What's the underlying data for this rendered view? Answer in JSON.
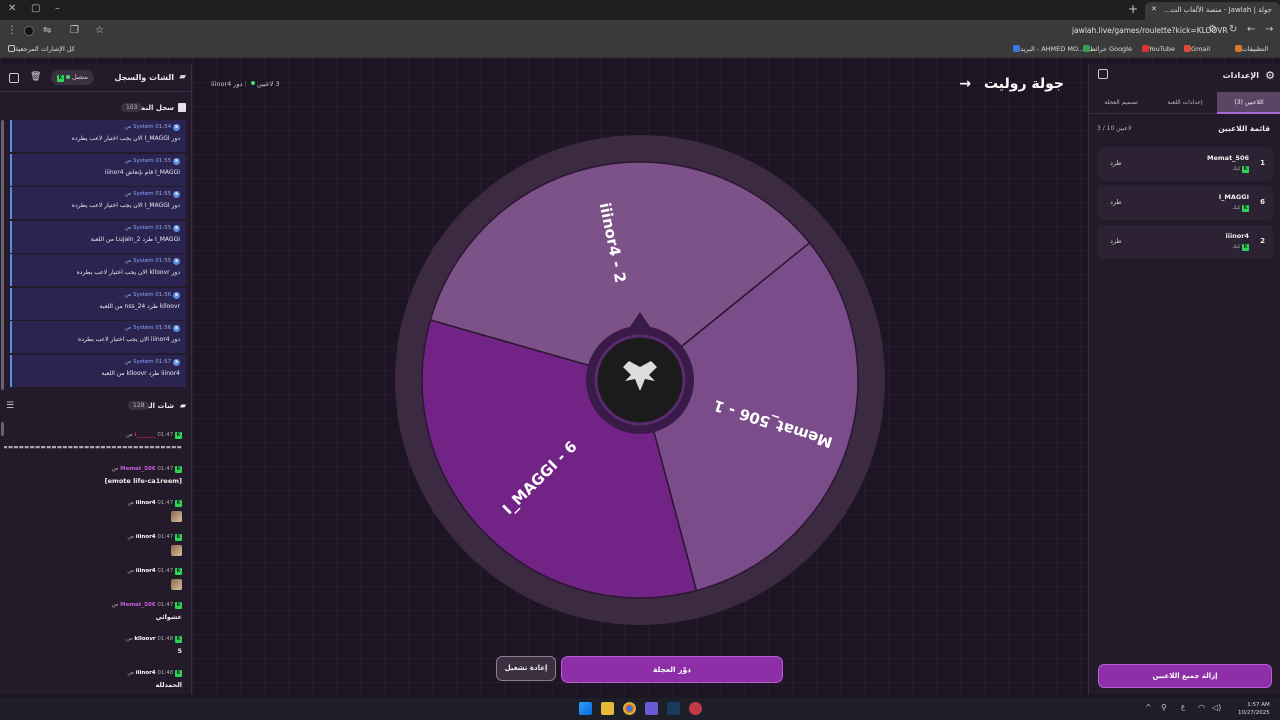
{
  "browser": {
    "tab_title": "جولة | Jawlah - منصة الألعاب الت...",
    "url": "jawlah.live/games/roulette?kick=KLOOVR",
    "bookmarks": [
      "التطبيقات",
      "Gmail",
      "YouTube",
      "خرائط Google",
      "البريد - AHMED MO...",
      "كل الإشارات المرجعية"
    ]
  },
  "left_panel": {
    "title": "الشات والسجل",
    "online_label": "متصل",
    "system_log": {
      "title": "سجل النظام",
      "count": "103",
      "messages": [
        {
          "sender": "System",
          "time": "01:54 ص",
          "text": "دور I_MAGGI الان يجب اختيار لاعب يطرده"
        },
        {
          "sender": "System",
          "time": "01:55 ص",
          "text": "I_MAGGI قام بإنعاش iiinor4"
        },
        {
          "sender": "System",
          "time": "01:55 ص",
          "text": "دور I_MAGGI الان يجب اختيار لاعب يطرده"
        },
        {
          "sender": "System",
          "time": "01:55 ص",
          "text": "I_MAGGI طرد Lujain_2 من اللعبة"
        },
        {
          "sender": "System",
          "time": "01:55 ص",
          "text": "دور klloovr الان يجب اختيار لاعب يطرده"
        },
        {
          "sender": "System",
          "time": "01:56 ص",
          "text": "klloovr طرد nss_24 من اللعبة"
        },
        {
          "sender": "System",
          "time": "01:56 ص",
          "text": "دور iiinor4 الان يجب اختيار لاعب يطرده"
        },
        {
          "sender": "System",
          "time": "01:57 ص",
          "text": "iiinor4 طرد klloovr من اللعبة"
        }
      ]
    },
    "live_chat": {
      "title": "شات البث",
      "count": "128",
      "messages": [
        {
          "name": "i_______",
          "name_color": "#e0245e",
          "time": "01:47 ص",
          "body": "==================================",
          "image": false
        },
        {
          "name": "Memat_506",
          "name_color": "#c060e0",
          "time": "01:47 ص",
          "body": "[emote life-ca1reem]",
          "image": false
        },
        {
          "name": "iiinor4",
          "name_color": "#ffffff",
          "time": "01:47 ص",
          "body": "",
          "image": true
        },
        {
          "name": "iiinor4",
          "name_color": "#ffffff",
          "time": "01:47 ص",
          "body": "",
          "image": true
        },
        {
          "name": "iiinor4",
          "name_color": "#ffffff",
          "time": "01:47 ص",
          "body": "",
          "image": true
        },
        {
          "name": "Memat_506",
          "name_color": "#c060e0",
          "time": "01:47 ص",
          "body": "عشوائي",
          "image": false
        },
        {
          "name": "klloovr",
          "name_color": "#ffffff",
          "time": "01:48 ص",
          "body": "5",
          "image": false
        },
        {
          "name": "iiinor4",
          "name_color": "#ffffff",
          "time": "01:48 ص",
          "body": "الحمدلله",
          "image": false
        }
      ]
    }
  },
  "center": {
    "title": "جولة روليت",
    "players_count": "3 لاعبين",
    "turn": "دور iiinor4",
    "wheel_segments": [
      {
        "label": "Memat_506 - 1",
        "color": "#7a4d8a"
      },
      {
        "label": "I_MAGGI - 6",
        "color": "#722386"
      },
      {
        "label": "iiinor4 - 2",
        "color": "#7c5288"
      }
    ],
    "spin_button": "دوّر العجلة",
    "restart_button": "إعادة تشغيل"
  },
  "right_panel": {
    "title": "الإعدادات",
    "tabs": [
      "اللاعبين (3)",
      "إعدادات اللعبة",
      "تصميم العجلة"
    ],
    "players_title": "قائمة اللاعبين",
    "players_count": "3 / 10 لاعبين",
    "players": [
      {
        "num": "1",
        "name": "Memat_506",
        "sub": "كيك",
        "kick": "طرد"
      },
      {
        "num": "6",
        "name": "I_MAGGI",
        "sub": "كيك",
        "kick": "طرد"
      },
      {
        "num": "2",
        "name": "iiinor4",
        "sub": "كيك",
        "kick": "طرد"
      }
    ],
    "remove_all": "إزالة جميع اللاعبين"
  },
  "taskbar": {
    "time": "1:57 AM",
    "date": "10/27/2025",
    "lang": "ع"
  }
}
